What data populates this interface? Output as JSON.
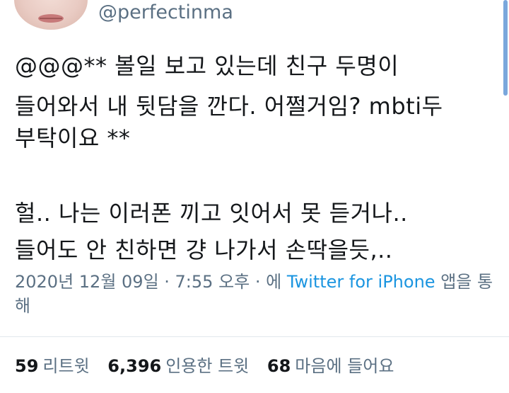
{
  "author": {
    "handle": "@perfectinma"
  },
  "tweet": {
    "lines": [
      "@@@** 볼일 보고 있는데 친구 두명이",
      "들어와서 내 뒷담을 깐다. 어쩔거임? mbti두",
      "부탁이요 **",
      "헐.. 나는 이러폰 끼고 잇어서 못 듣거나..",
      "들어도 안 친하면 걍 나가서 손딱을듯,.."
    ]
  },
  "meta": {
    "timestamp": "2020년 12월 09일 · 7:55 오후 · 에",
    "source": "Twitter for iPhone",
    "suffix": "앱을 통해"
  },
  "stats": {
    "retweets_count": "59",
    "retweets_label": "리트윗",
    "quotes_count": "6,396",
    "quotes_label": "인용한 트윗",
    "likes_count": "68",
    "likes_label": "마음에 들어요"
  },
  "colors": {
    "secondary_text": "#5b7083",
    "link": "#1b95e0",
    "scrollbar": "#7aa7dc"
  }
}
